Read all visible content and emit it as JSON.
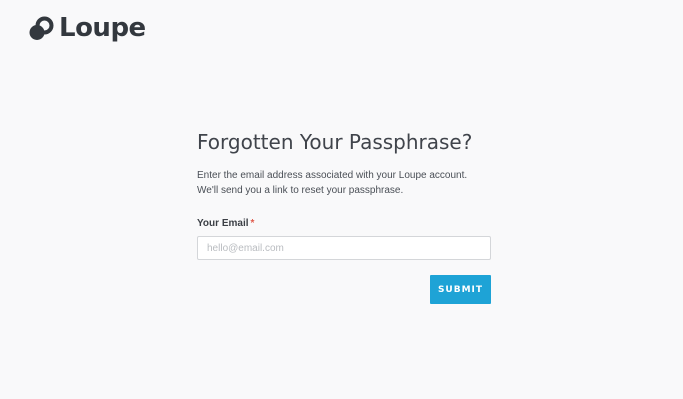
{
  "brand": {
    "name": "Loupe",
    "logo_icon": "loupe-logo-icon"
  },
  "form": {
    "title": "Forgotten Your Passphrase?",
    "description_line1": "Enter the email address associated with your Loupe account.",
    "description_line2": "We'll send you a link to reset your passphrase.",
    "email_label": "Your Email",
    "required_marker": "*",
    "email_placeholder": "hello@email.com",
    "email_value": "",
    "submit_label": "SUBMIT"
  },
  "colors": {
    "accent": "#1ea3d6",
    "required": "#e05a4b",
    "background": "#f9f9fa"
  }
}
